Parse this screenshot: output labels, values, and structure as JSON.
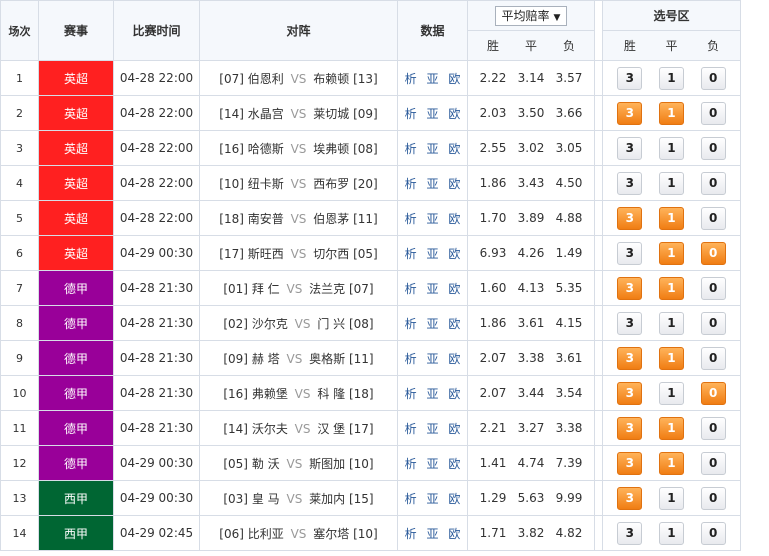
{
  "colors": {
    "premier_league": "#ff2020",
    "bundesliga": "#990099",
    "la_liga": "#006633",
    "selected_button": "#f07d13"
  },
  "header": {
    "col_no": "场次",
    "col_league": "赛事",
    "col_time": "比赛时间",
    "col_match": "对阵",
    "col_data": "数据",
    "odds_selector": "平均赔率",
    "odds_labels": [
      "胜",
      "平",
      "负"
    ],
    "select_title": "选号区",
    "select_labels": [
      "胜",
      "平",
      "负"
    ]
  },
  "rows": [
    {
      "no": "1",
      "league": "英超",
      "league_key": "premier_league",
      "time": "04-28 22:00",
      "home_rank": "[07]",
      "home": "伯恩利",
      "away": "布赖顿",
      "away_rank": "[13]",
      "data": [
        "析",
        "亚",
        "欧"
      ],
      "odds": [
        "2.22",
        "3.14",
        "3.57"
      ],
      "sel": [
        {
          "label": "3",
          "on": false
        },
        {
          "label": "1",
          "on": false
        },
        {
          "label": "0",
          "on": false
        }
      ]
    },
    {
      "no": "2",
      "league": "英超",
      "league_key": "premier_league",
      "time": "04-28 22:00",
      "home_rank": "[14]",
      "home": "水晶宫",
      "away": "莱切城",
      "away_rank": "[09]",
      "data": [
        "析",
        "亚",
        "欧"
      ],
      "odds": [
        "2.03",
        "3.50",
        "3.66"
      ],
      "sel": [
        {
          "label": "3",
          "on": true
        },
        {
          "label": "1",
          "on": true
        },
        {
          "label": "0",
          "on": false
        }
      ]
    },
    {
      "no": "3",
      "league": "英超",
      "league_key": "premier_league",
      "time": "04-28 22:00",
      "home_rank": "[16]",
      "home": "哈德斯",
      "away": "埃弗顿",
      "away_rank": "[08]",
      "data": [
        "析",
        "亚",
        "欧"
      ],
      "odds": [
        "2.55",
        "3.02",
        "3.05"
      ],
      "sel": [
        {
          "label": "3",
          "on": false
        },
        {
          "label": "1",
          "on": false
        },
        {
          "label": "0",
          "on": false
        }
      ]
    },
    {
      "no": "4",
      "league": "英超",
      "league_key": "premier_league",
      "time": "04-28 22:00",
      "home_rank": "[10]",
      "home": "纽卡斯",
      "away": "西布罗",
      "away_rank": "[20]",
      "data": [
        "析",
        "亚",
        "欧"
      ],
      "odds": [
        "1.86",
        "3.43",
        "4.50"
      ],
      "sel": [
        {
          "label": "3",
          "on": false
        },
        {
          "label": "1",
          "on": false
        },
        {
          "label": "0",
          "on": false
        }
      ]
    },
    {
      "no": "5",
      "league": "英超",
      "league_key": "premier_league",
      "time": "04-28 22:00",
      "home_rank": "[18]",
      "home": "南安普",
      "away": "伯恩茅",
      "away_rank": "[11]",
      "data": [
        "析",
        "亚",
        "欧"
      ],
      "odds": [
        "1.70",
        "3.89",
        "4.88"
      ],
      "sel": [
        {
          "label": "3",
          "on": true
        },
        {
          "label": "1",
          "on": true
        },
        {
          "label": "0",
          "on": false
        }
      ]
    },
    {
      "no": "6",
      "league": "英超",
      "league_key": "premier_league",
      "time": "04-29 00:30",
      "home_rank": "[17]",
      "home": "斯旺西",
      "away": "切尔西",
      "away_rank": "[05]",
      "data": [
        "析",
        "亚",
        "欧"
      ],
      "odds": [
        "6.93",
        "4.26",
        "1.49"
      ],
      "sel": [
        {
          "label": "3",
          "on": false
        },
        {
          "label": "1",
          "on": true
        },
        {
          "label": "0",
          "on": true
        }
      ]
    },
    {
      "no": "7",
      "league": "德甲",
      "league_key": "bundesliga",
      "time": "04-28 21:30",
      "home_rank": "[01]",
      "home": "拜 仁",
      "away": "法兰克",
      "away_rank": "[07]",
      "data": [
        "析",
        "亚",
        "欧"
      ],
      "odds": [
        "1.60",
        "4.13",
        "5.35"
      ],
      "sel": [
        {
          "label": "3",
          "on": true
        },
        {
          "label": "1",
          "on": true
        },
        {
          "label": "0",
          "on": false
        }
      ]
    },
    {
      "no": "8",
      "league": "德甲",
      "league_key": "bundesliga",
      "time": "04-28 21:30",
      "home_rank": "[02]",
      "home": "沙尔克",
      "away": "门 兴",
      "away_rank": "[08]",
      "data": [
        "析",
        "亚",
        "欧"
      ],
      "odds": [
        "1.86",
        "3.61",
        "4.15"
      ],
      "sel": [
        {
          "label": "3",
          "on": false
        },
        {
          "label": "1",
          "on": false
        },
        {
          "label": "0",
          "on": false
        }
      ]
    },
    {
      "no": "9",
      "league": "德甲",
      "league_key": "bundesliga",
      "time": "04-28 21:30",
      "home_rank": "[09]",
      "home": "赫 塔",
      "away": "奥格斯",
      "away_rank": "[11]",
      "data": [
        "析",
        "亚",
        "欧"
      ],
      "odds": [
        "2.07",
        "3.38",
        "3.61"
      ],
      "sel": [
        {
          "label": "3",
          "on": true
        },
        {
          "label": "1",
          "on": true
        },
        {
          "label": "0",
          "on": false
        }
      ]
    },
    {
      "no": "10",
      "league": "德甲",
      "league_key": "bundesliga",
      "time": "04-28 21:30",
      "home_rank": "[16]",
      "home": "弗赖堡",
      "away": "科 隆",
      "away_rank": "[18]",
      "data": [
        "析",
        "亚",
        "欧"
      ],
      "odds": [
        "2.07",
        "3.44",
        "3.54"
      ],
      "sel": [
        {
          "label": "3",
          "on": true
        },
        {
          "label": "1",
          "on": false
        },
        {
          "label": "0",
          "on": true
        }
      ]
    },
    {
      "no": "11",
      "league": "德甲",
      "league_key": "bundesliga",
      "time": "04-28 21:30",
      "home_rank": "[14]",
      "home": "沃尔夫",
      "away": "汉 堡",
      "away_rank": "[17]",
      "data": [
        "析",
        "亚",
        "欧"
      ],
      "odds": [
        "2.21",
        "3.27",
        "3.38"
      ],
      "sel": [
        {
          "label": "3",
          "on": true
        },
        {
          "label": "1",
          "on": true
        },
        {
          "label": "0",
          "on": false
        }
      ]
    },
    {
      "no": "12",
      "league": "德甲",
      "league_key": "bundesliga",
      "time": "04-29 00:30",
      "home_rank": "[05]",
      "home": "勒 沃",
      "away": "斯图加",
      "away_rank": "[10]",
      "data": [
        "析",
        "亚",
        "欧"
      ],
      "odds": [
        "1.41",
        "4.74",
        "7.39"
      ],
      "sel": [
        {
          "label": "3",
          "on": true
        },
        {
          "label": "1",
          "on": true
        },
        {
          "label": "0",
          "on": false
        }
      ]
    },
    {
      "no": "13",
      "league": "西甲",
      "league_key": "la_liga",
      "time": "04-29 00:30",
      "home_rank": "[03]",
      "home": "皇 马",
      "away": "莱加内",
      "away_rank": "[15]",
      "data": [
        "析",
        "亚",
        "欧"
      ],
      "odds": [
        "1.29",
        "5.63",
        "9.99"
      ],
      "sel": [
        {
          "label": "3",
          "on": true
        },
        {
          "label": "1",
          "on": false
        },
        {
          "label": "0",
          "on": false
        }
      ]
    },
    {
      "no": "14",
      "league": "西甲",
      "league_key": "la_liga",
      "time": "04-29 02:45",
      "home_rank": "[06]",
      "home": "比利亚",
      "away": "塞尔塔",
      "away_rank": "[10]",
      "data": [
        "析",
        "亚",
        "欧"
      ],
      "odds": [
        "1.71",
        "3.82",
        "4.82"
      ],
      "sel": [
        {
          "label": "3",
          "on": false
        },
        {
          "label": "1",
          "on": false
        },
        {
          "label": "0",
          "on": false
        }
      ]
    }
  ]
}
